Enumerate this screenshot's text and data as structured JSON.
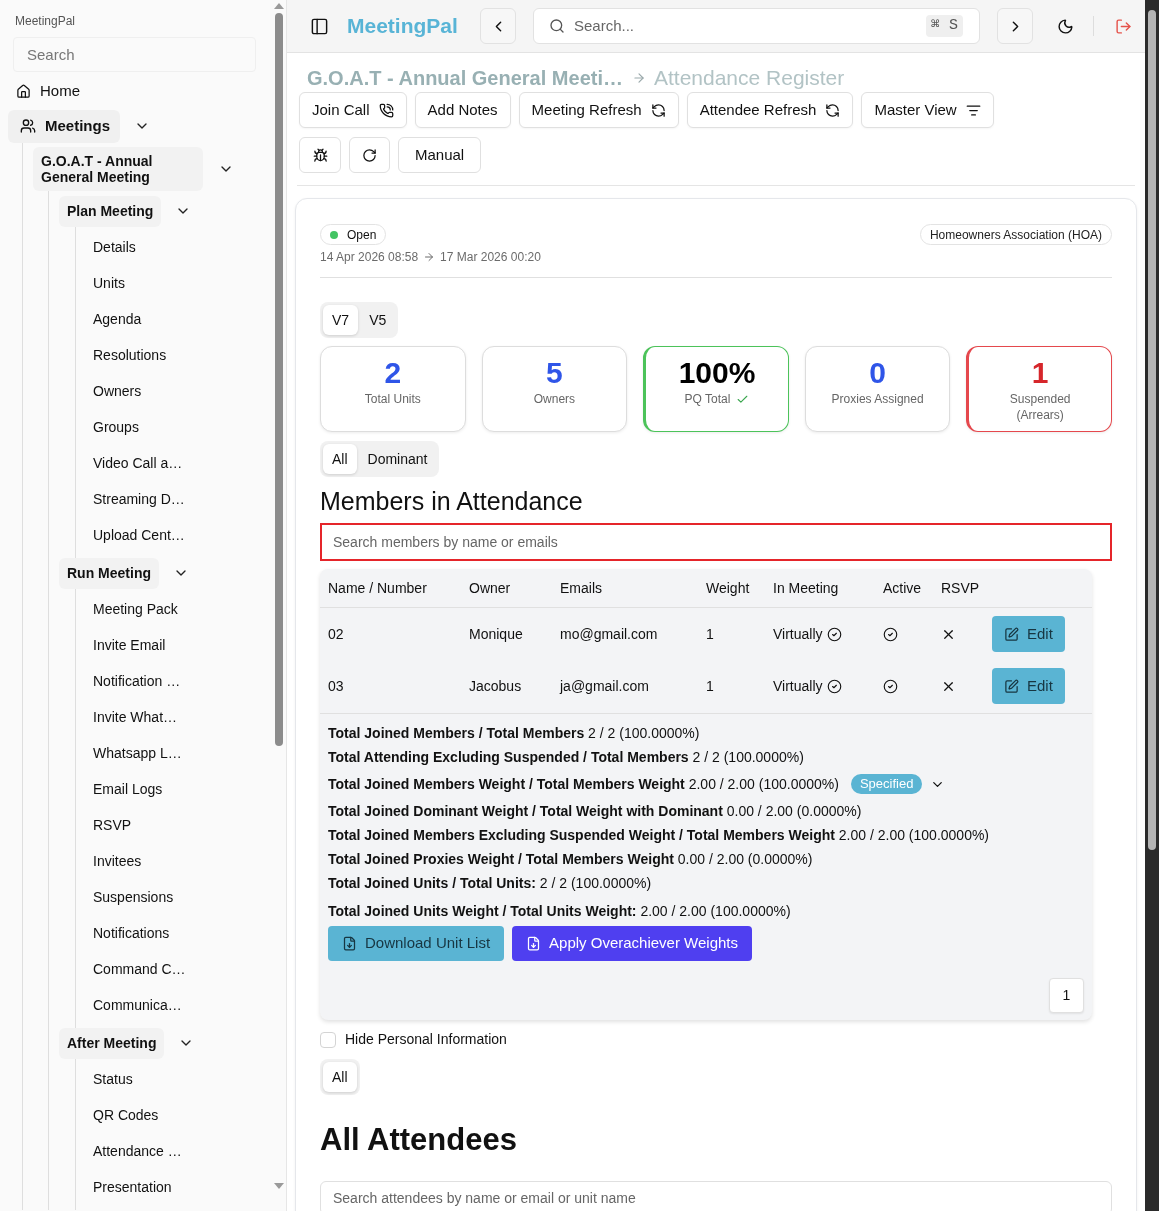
{
  "sidebar": {
    "app_name": "MeetingPal",
    "search": {
      "placeholder": "Search"
    },
    "items": [
      {
        "label": "Home"
      },
      {
        "label": "Meetings",
        "expanded": true,
        "children": [
          {
            "label": "G.O.A.T - Annual General Meeting",
            "expanded": true,
            "children": [
              {
                "label": "Plan Meeting",
                "expanded": true,
                "children": [
                  {
                    "label": "Details"
                  },
                  {
                    "label": "Units"
                  },
                  {
                    "label": "Agenda"
                  },
                  {
                    "label": "Resolutions"
                  },
                  {
                    "label": "Owners"
                  },
                  {
                    "label": "Groups"
                  },
                  {
                    "label": "Video Call a…"
                  },
                  {
                    "label": "Streaming D…"
                  },
                  {
                    "label": "Upload Cent…"
                  }
                ]
              },
              {
                "label": "Run Meeting",
                "expanded": true,
                "children": [
                  {
                    "label": "Meeting Pack"
                  },
                  {
                    "label": "Invite Email"
                  },
                  {
                    "label": "Notification …"
                  },
                  {
                    "label": "Invite What…"
                  },
                  {
                    "label": "Whatsapp L…"
                  },
                  {
                    "label": "Email Logs"
                  },
                  {
                    "label": "RSVP"
                  },
                  {
                    "label": "Invitees"
                  },
                  {
                    "label": "Suspensions"
                  },
                  {
                    "label": "Notifications"
                  },
                  {
                    "label": "Command C…"
                  },
                  {
                    "label": "Communica…"
                  }
                ]
              },
              {
                "label": "After Meeting",
                "expanded": true,
                "children": [
                  {
                    "label": "Status"
                  },
                  {
                    "label": "QR Codes"
                  },
                  {
                    "label": "Attendance …"
                  },
                  {
                    "label": "Presentation"
                  }
                ]
              }
            ]
          }
        ]
      }
    ]
  },
  "top_bar": {
    "brand": "MeetingPal",
    "search": {
      "placeholder": "Search...",
      "shortcut": "⌘ S"
    }
  },
  "breadcrumb": [
    "G.O.A.T - Annual General Meeti…",
    "Attendance Register"
  ],
  "toolbar": {
    "buttons": [
      "Join Call",
      "Add Notes",
      "Meeting Refresh",
      "Attendee Refresh",
      "Master View"
    ],
    "secondary_buttons": [
      "Manual"
    ]
  },
  "meeting": {
    "status": {
      "label": "Open",
      "color": "#43c463"
    },
    "start": "14 Apr 2026 08:58",
    "end": "17 Mar 2026 00:20",
    "organisation": "Homeowners Association (HOA)",
    "version_tabs": [
      {
        "label": "V7",
        "selected": true
      },
      {
        "label": "V5",
        "selected": false
      }
    ],
    "stats": [
      {
        "value": "2",
        "label": "Total Units",
        "kind": "info",
        "verified": false
      },
      {
        "value": "5",
        "label": "Owners",
        "kind": "info",
        "verified": false
      },
      {
        "value": "100%",
        "label": "PQ Total",
        "kind": "success",
        "verified": true
      },
      {
        "value": "0",
        "label": "Proxies Assigned",
        "kind": "info",
        "verified": false
      },
      {
        "value": "1",
        "label": "Suspended (Arrears)",
        "kind": "danger",
        "verified": false
      }
    ],
    "filter_tabs": [
      {
        "label": "All",
        "selected": true
      },
      {
        "label": "Dominant",
        "selected": false
      }
    ]
  },
  "members": {
    "title": "Members in Attendance",
    "search": {
      "placeholder": "Search members by name or emails"
    },
    "columns": [
      "Name / Number",
      "Owner",
      "Emails",
      "Weight",
      "In Meeting",
      "Active",
      "RSVP"
    ],
    "rows": [
      {
        "name": "02",
        "owner": "Monique",
        "email": "mo@gmail.com",
        "weight": "1",
        "in_meeting": "Virtually",
        "active": true,
        "rsvp": false,
        "action": "Edit"
      },
      {
        "name": "03",
        "owner": "Jacobus",
        "email": "ja@gmail.com",
        "weight": "1",
        "in_meeting": "Virtually",
        "active": true,
        "rsvp": false,
        "action": "Edit"
      }
    ],
    "summary": [
      {
        "text": "**Total Joined Members / Total Members** 2 / 2 (100.0000%)"
      },
      {
        "text": "**Total Attending Excluding Suspended / Total Members** 2 / 2 (100.0000%)"
      },
      {
        "text": "**Total Joined Members Weight / Total Members Weight** 2.00 / 2.00 (100.0000%)",
        "badge": "Specified"
      },
      {
        "text": "**Total Joined Dominant Weight / Total Weight with Dominant** 0.00 / 2.00 (0.0000%)"
      },
      {
        "text": "**Total Joined Members Excluding Suspended Weight / Total Members Weight** 2.00 / 2.00 (100.0000%)"
      },
      {
        "text": "**Total Joined Proxies Weight / Total Members Weight** 0.00 / 2.00 (0.0000%)"
      },
      {
        "text": "**Total Joined Units / Total Units:** 2 / 2 (100.0000%)"
      },
      {
        "text": "**Total Joined Units Weight / Total Units Weight:** 2.00 / 2.00 (100.0000%)"
      }
    ],
    "actions": [
      {
        "label": "Download Unit List",
        "kind": "info"
      },
      {
        "label": "Apply Overachiever Weights",
        "kind": "primary"
      }
    ],
    "pages": [
      {
        "label": "1",
        "selected": true
      }
    ]
  },
  "hide_personal_information": {
    "label": "Hide Personal Information",
    "checked": false
  },
  "attendee_tabs": [
    {
      "label": "All",
      "selected": true
    }
  ],
  "attendees": {
    "title": "All Attendees",
    "search": {
      "placeholder": "Search attendees by name or email or unit name"
    }
  }
}
